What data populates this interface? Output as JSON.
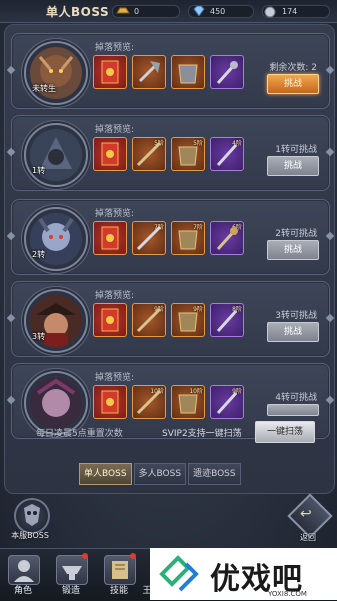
{
  "header": {
    "title": "单人BOSS",
    "gold": "0",
    "gems": "450",
    "silver": "174"
  },
  "drop_preview_label": "掉落预览:",
  "bosses": [
    {
      "rebirth": "未转生",
      "status": "剩余次数: 2",
      "button": "挑战",
      "button_active": true,
      "items": [
        {
          "rarity": "red",
          "lvl": ""
        },
        {
          "rarity": "orange",
          "lvl": ""
        },
        {
          "rarity": "orange",
          "lvl": ""
        },
        {
          "rarity": "purple",
          "lvl": ""
        }
      ]
    },
    {
      "rebirth": "1转",
      "status": "1转可挑战",
      "button": "挑战",
      "button_active": false,
      "items": [
        {
          "rarity": "red",
          "lvl": ""
        },
        {
          "rarity": "orange",
          "lvl": "5阶"
        },
        {
          "rarity": "orange",
          "lvl": "5阶"
        },
        {
          "rarity": "purple",
          "lvl": "4阶"
        }
      ]
    },
    {
      "rebirth": "2转",
      "status": "2转可挑战",
      "button": "挑战",
      "button_active": false,
      "items": [
        {
          "rarity": "red",
          "lvl": ""
        },
        {
          "rarity": "orange",
          "lvl": "7阶"
        },
        {
          "rarity": "orange",
          "lvl": "7阶"
        },
        {
          "rarity": "purple",
          "lvl": "6阶"
        }
      ]
    },
    {
      "rebirth": "3转",
      "status": "3转可挑战",
      "button": "挑战",
      "button_active": false,
      "items": [
        {
          "rarity": "red",
          "lvl": ""
        },
        {
          "rarity": "orange",
          "lvl": "9阶"
        },
        {
          "rarity": "orange",
          "lvl": "9阶"
        },
        {
          "rarity": "purple",
          "lvl": "8阶"
        }
      ]
    },
    {
      "rebirth": "",
      "status": "4转可挑战",
      "button": "挑战",
      "button_active": false,
      "items": [
        {
          "rarity": "red",
          "lvl": ""
        },
        {
          "rarity": "orange",
          "lvl": "10阶"
        },
        {
          "rarity": "orange",
          "lvl": "10阶"
        },
        {
          "rarity": "purple",
          "lvl": "9阶"
        }
      ]
    }
  ],
  "footer": {
    "reset_text": "每日凌晨5点重置次数",
    "svip_text": "SVIP2支持一键扫荡",
    "sweep_button": "一键扫荡"
  },
  "tabs": [
    "单人BOSS",
    "多人BOSS",
    "遗迹BOSS"
  ],
  "bottom": {
    "server_boss": "本服BOSS",
    "back": "返回",
    "nav": [
      "角色",
      "锻造",
      "技能",
      "王"
    ]
  },
  "watermark": {
    "text": "优戏吧",
    "url": "YOXI8.COM"
  }
}
